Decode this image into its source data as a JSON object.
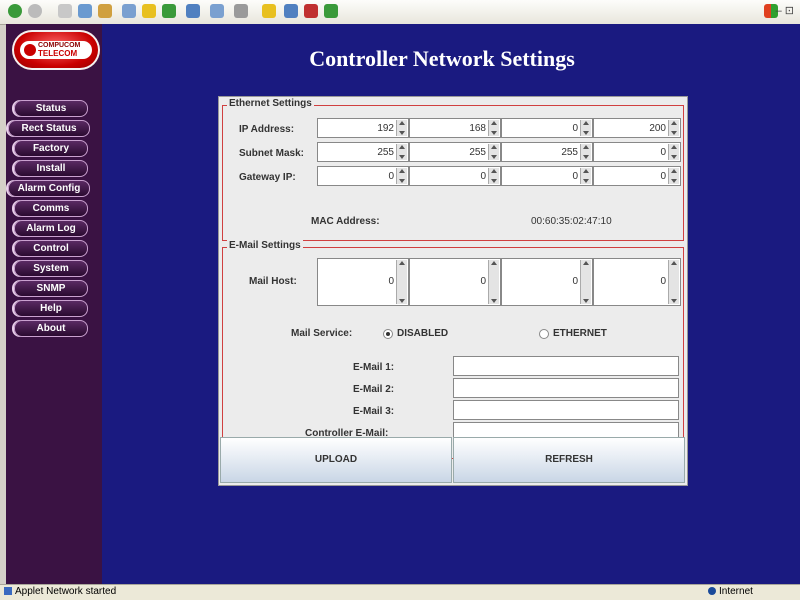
{
  "browser": {
    "window_controls": "– ⊡",
    "toolbar_icons": [
      "back-icon",
      "forward-icon",
      "stop-icon",
      "refresh-icon",
      "home-icon",
      "search-icon",
      "favorites-icon",
      "media-icon",
      "history-icon",
      "mail-icon",
      "print-icon",
      "edit-icon",
      "discuss-icon",
      "messenger-icon",
      "research-icon"
    ]
  },
  "sidebar": {
    "logo_text_top": "COMPUCOM",
    "logo_text": "TELECOM",
    "items": [
      "Status",
      "Rect Status",
      "Factory",
      "Install",
      "Alarm Config",
      "Comms",
      "Alarm Log",
      "Control",
      "System",
      "SNMP",
      "Help",
      "About"
    ]
  },
  "page_title": "Controller Network Settings",
  "ethernet": {
    "label": "Ethernet Settings",
    "ip_label": "IP Address:",
    "ip": [
      "192",
      "168",
      "0",
      "200"
    ],
    "subnet_label": "Subnet Mask:",
    "subnet": [
      "255",
      "255",
      "255",
      "0"
    ],
    "gateway_label": "Gateway IP:",
    "gateway": [
      "0",
      "0",
      "0",
      "0"
    ],
    "mac_label": "MAC Address:",
    "mac": "00:60:35:02:47:10"
  },
  "email": {
    "label": "E-Mail Settings",
    "host_label": "Mail Host:",
    "host": [
      "0",
      "0",
      "0",
      "0"
    ],
    "service_label": "Mail Service:",
    "option_disabled": "DISABLED",
    "option_ethernet": "ETHERNET",
    "selected": "DISABLED",
    "email1_label": "E-Mail 1:",
    "email2_label": "E-Mail 2:",
    "email3_label": "E-Mail 3:",
    "controller_label": "Controller E-Mail:",
    "email1": "",
    "email2": "",
    "email3": "",
    "controller": ""
  },
  "buttons": {
    "upload": "UPLOAD",
    "refresh": "REFRESH"
  },
  "statusbar": {
    "left": "Applet Network started",
    "right": "Internet"
  },
  "colors": {
    "page_bg": "#1a1a80",
    "sidebar_bg": "#3a1243",
    "group_border": "#d04040"
  }
}
